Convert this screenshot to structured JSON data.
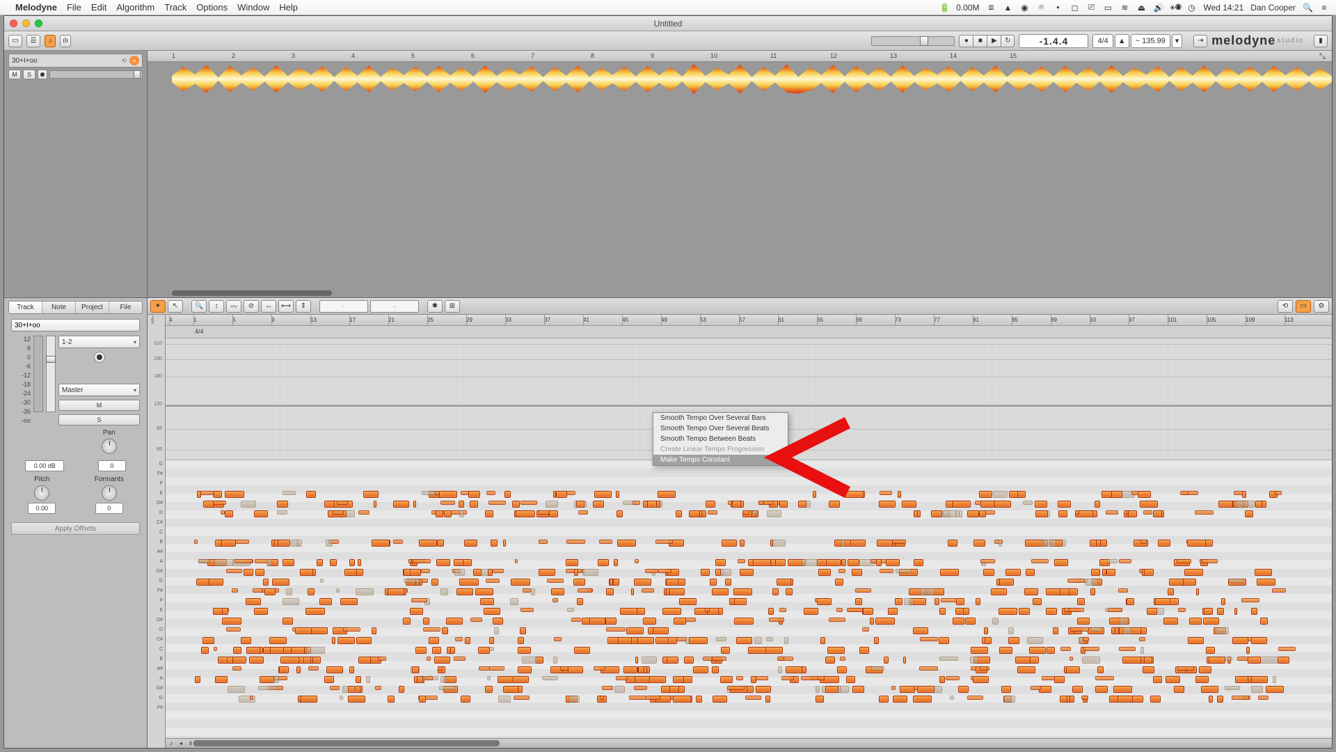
{
  "menubar": {
    "app": "Melodyne",
    "items": [
      "File",
      "Edit",
      "Algorithm",
      "Track",
      "Options",
      "Window",
      "Help"
    ],
    "status": {
      "battery": "0.00M",
      "time": "Wed 14:21",
      "user": "Dan Cooper"
    }
  },
  "window": {
    "title": "Untitled"
  },
  "transport": {
    "counter": "-1.4.4",
    "timesig": "4/4",
    "tempo": "~ 135.99"
  },
  "logo": {
    "brand": "melodyne",
    "edition": "studio"
  },
  "overview": {
    "ruler_ticks": [
      "1",
      "2",
      "3",
      "4",
      "5",
      "6",
      "7",
      "8",
      "9",
      "10",
      "11",
      "12",
      "13",
      "14",
      "15"
    ],
    "track": {
      "name": "30+I+oo",
      "mute": "M",
      "solo": "S"
    }
  },
  "inspector": {
    "tabs": [
      "Track",
      "Note",
      "Project",
      "File"
    ],
    "active_tab": "Track",
    "track_name": "30+I+oo",
    "scale_labels": [
      "12",
      "6",
      "0",
      "-6",
      "-12",
      "-18",
      "-24",
      "-30",
      "-36",
      "-oo"
    ],
    "channel_sel": "1-2",
    "master_sel": "Master",
    "m_btn": "M",
    "s_btn": "S",
    "gain": "0.00 dB",
    "pan_val": "0",
    "pitch_label": "Pitch",
    "formants_label": "Formants",
    "pitch_val": "0.00",
    "formants_val": "0",
    "pan_label": "Pan",
    "apply": "Apply Offsets"
  },
  "editor": {
    "ruler_bars": [
      "4",
      "1",
      "5",
      "9",
      "13",
      "17",
      "21",
      "25",
      "29",
      "33",
      "37",
      "41",
      "45",
      "49",
      "53",
      "57",
      "61",
      "65",
      "69",
      "73",
      "77",
      "81",
      "85",
      "89",
      "93",
      "97",
      "101",
      "105",
      "109",
      "113"
    ],
    "timesig": "4/4",
    "tempo_scale": [
      "310",
      "230",
      "180",
      "120",
      "85",
      "65"
    ],
    "pitch_names": [
      "G",
      "F#",
      "F",
      "E",
      "D#",
      "D",
      "C#",
      "C",
      "B",
      "A#",
      "A",
      "G#",
      "G",
      "F#",
      "F",
      "E",
      "D#",
      "D",
      "C#",
      "C",
      "B",
      "A#",
      "A",
      "G#",
      "G",
      "F#"
    ],
    "tool_val1": "-",
    "tool_val2": "-"
  },
  "context_menu": {
    "items": [
      {
        "label": "Smooth Tempo Over Several Bars",
        "state": "normal"
      },
      {
        "label": "Smooth Tempo Over Several Beats",
        "state": "normal"
      },
      {
        "label": "Smooth Tempo Between Beats",
        "state": "normal"
      },
      {
        "label": "Create Linear Tempo Progression",
        "state": "disabled"
      },
      {
        "label": "Make Tempo Constant",
        "state": "highlight"
      }
    ]
  }
}
